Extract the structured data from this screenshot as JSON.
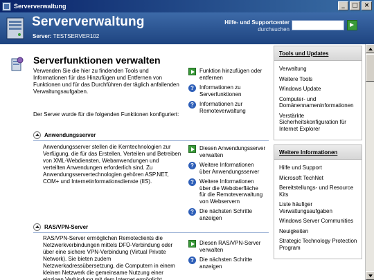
{
  "window": {
    "title": "Serververwaltung"
  },
  "banner": {
    "app_title": "Serververwaltung",
    "server_label": "Server:",
    "server_name": "TESTSERVER102",
    "help_title": "Hilfe- und Supportcenter",
    "help_sub": "durchsuchen",
    "search_value": ""
  },
  "main": {
    "title": "Serverfunktionen verwalten",
    "intro": "Verwenden Sie die hier zu findenden Tools und Informationen für das Hinzufügen und Entfernen von Funktionen und für das Durchführen der täglich anfallenden Verwaltungsaufgaben.",
    "intro_links": [
      "Funktion hinzufügen oder entfernen",
      "Informationen zu Serverfunktionen",
      "Informationen zur Remoteverwaltung"
    ],
    "configured_text": "Der Server wurde für die folgenden Funktionen konfiguriert:",
    "roles": [
      {
        "name": "Anwendungsserver",
        "description": "Anwendungsserver stellen die Kerntechnologien zur Verfügung, die für das Erstellen, Verteilen und Betreiben von XML-Webdiensten, Webanwendungen und verteilten Anwendungen erforderlich sind. Zu Anwendungsservertechnologien gehören ASP.NET, COM+ und Internetinformationsdienste (IIS).",
        "links": [
          "Diesen Anwendungsserver verwalten",
          "Weitere Informationen über Anwendungsserver",
          "Weitere Informationen über die Weboberfläche für die Remoteverwaltung von Webservern",
          "Die nächsten Schritte anzeigen"
        ]
      },
      {
        "name": "RAS/VPN-Server",
        "description": "RAS/VPN-Server ermöglichen Remoteclients die Netzwerkverbindungen mittels DFÜ-Verbindung oder über eine sichere VPN-Verbindung (Virtual Private Network). Sie bieten zudem Netzwerkadressübersetzung, die Computern in einem kleinen Netzwerk die gemeinsame Nutzung einer einzigen Verbindung mit dem Internet ermöglicht.",
        "links": [
          "Diesen RAS/VPN-Server verwalten",
          "Die nächsten Schritte anzeigen"
        ]
      }
    ]
  },
  "side": {
    "tools": {
      "title": "Tools und Updates",
      "items": [
        "Verwaltung",
        "Weitere Tools",
        "Windows Update",
        "Computer- und Domänennameninformationen",
        "Verstärkte Sicherheitskonfiguration für Internet Explorer"
      ]
    },
    "more": {
      "title": "Weitere Informationen",
      "items": [
        "Hilfe und Support",
        "Microsoft TechNet",
        "Bereitstellungs- und Resource Kits",
        "Liste häufiger Verwaltungsaufgaben",
        "Windows Server Communities",
        "Neuigkeiten",
        "Strategic Technology Protection Program"
      ]
    }
  },
  "colors": {
    "titlebar": "#0a246a",
    "banner": "#2d5896",
    "go_button": "#3a9a3a",
    "info_icon": "#2e5fb8"
  }
}
